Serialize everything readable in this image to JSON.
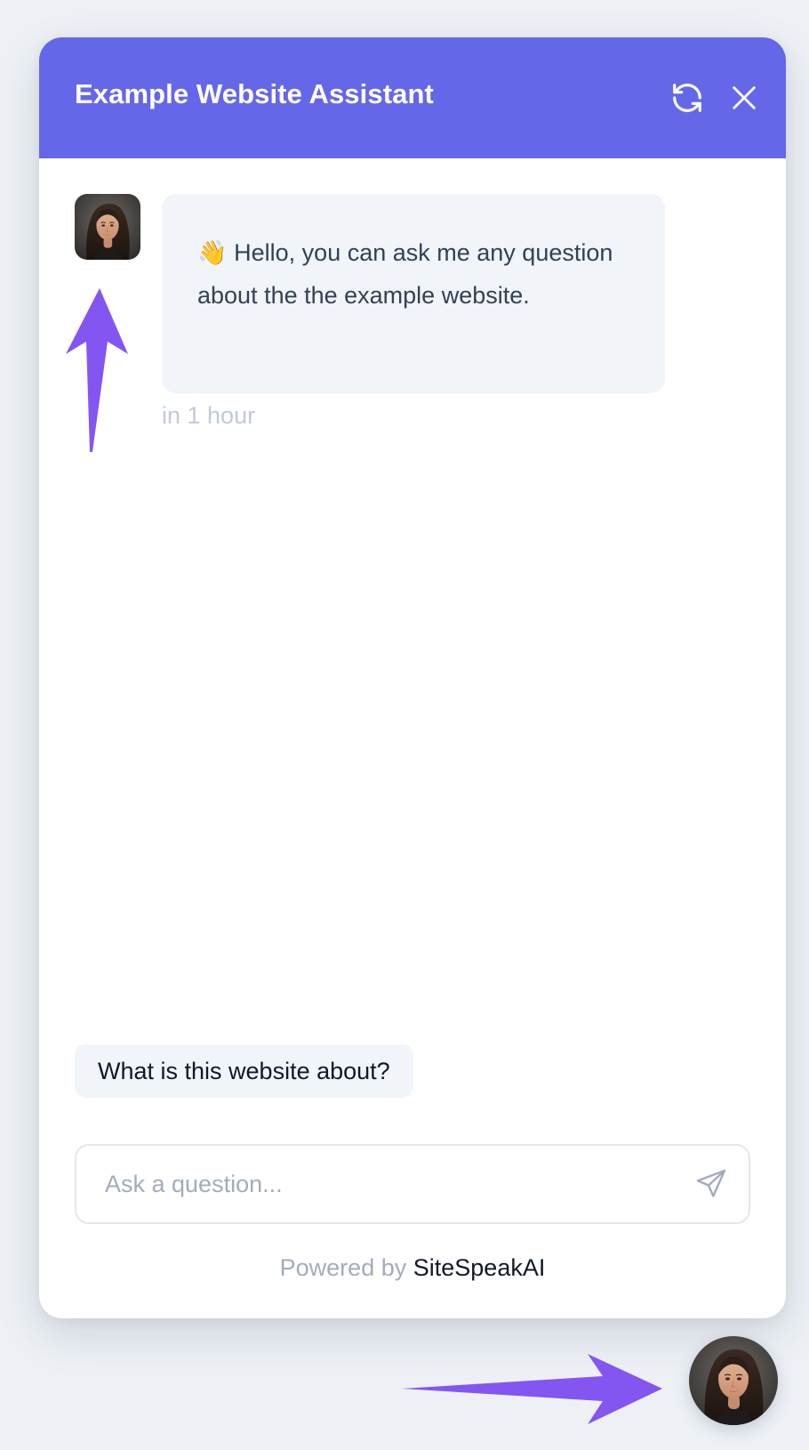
{
  "header": {
    "title": "Example Website Assistant",
    "refresh_icon": "refresh-icon",
    "close_icon": "close-icon",
    "color": "#6567e9"
  },
  "messages": [
    {
      "sender": "assistant",
      "avatar_icon": "assistant-avatar",
      "emoji": "👋",
      "text": "Hello, you can ask me any question about the the example website.",
      "time": "in 1 hour"
    }
  ],
  "suggestions": [
    "What is this website about?"
  ],
  "input": {
    "placeholder": "Ask a question...",
    "value": "",
    "send_icon": "send-icon"
  },
  "footer": {
    "prefix": "Powered by",
    "brand": "SiteSpeakAI"
  },
  "launcher": {
    "avatar_icon": "assistant-avatar"
  },
  "annotations": {
    "arrow_color": "#8356f2",
    "arrows": [
      "arrow-up-icon",
      "arrow-right-icon"
    ]
  }
}
